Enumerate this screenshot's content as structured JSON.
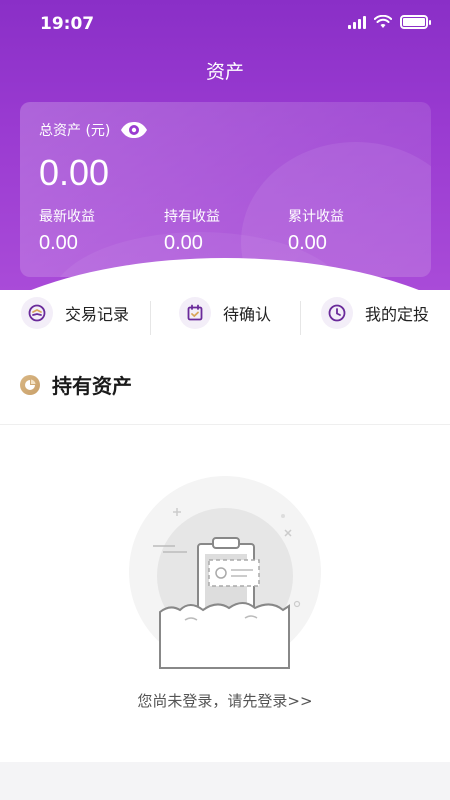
{
  "status_bar": {
    "time": "19:07"
  },
  "header": {
    "title": "资产"
  },
  "asset_card": {
    "total_label": "总资产 (元)",
    "total_value": "0.00",
    "stats": [
      {
        "label": "最新收益",
        "value": "0.00"
      },
      {
        "label": "持有收益",
        "value": "0.00"
      },
      {
        "label": "累计收益",
        "value": "0.00"
      }
    ]
  },
  "quick_actions": [
    {
      "label": "交易记录",
      "icon": "transaction-record-icon"
    },
    {
      "label": "待确认",
      "icon": "calendar-check-icon"
    },
    {
      "label": "我的定投",
      "icon": "clock-icon"
    }
  ],
  "holdings": {
    "title": "持有资产",
    "empty_message": "您尚未登录，请先登录>>"
  },
  "colors": {
    "header_gradient_start": "#8a2fc7",
    "header_gradient_end": "#a94bd8",
    "accent_purple": "#8a2fc7",
    "gold_icon": "#c9a06a"
  }
}
